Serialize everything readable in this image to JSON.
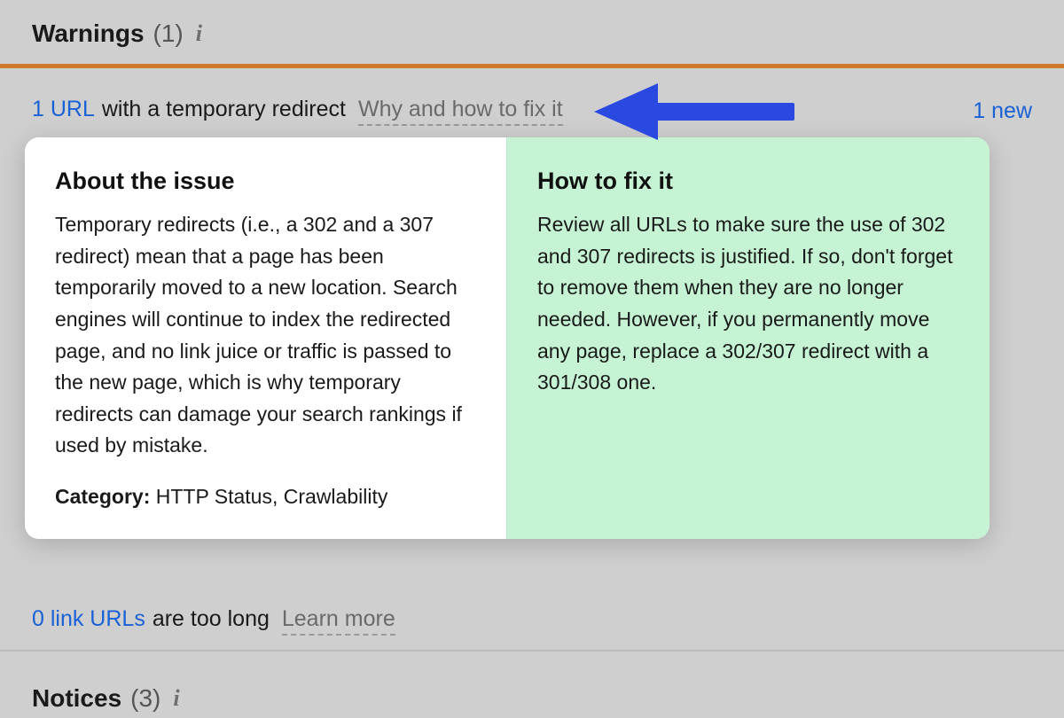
{
  "warnings": {
    "title": "Warnings",
    "count": "(1)"
  },
  "issue1": {
    "count_link": "1 URL",
    "text": "with a temporary redirect",
    "hint": "Why and how to fix it",
    "new_badge": "1 new"
  },
  "tooltip": {
    "about_heading": "About the issue",
    "about_body": "Temporary redirects (i.e., a 302 and a 307 redirect) mean that a page has been temporarily moved to a new location. Search engines will continue to index the redirected page, and no link juice or traffic is passed to the new page, which is why temporary redirects can damage your search rankings if used by mistake.",
    "category_label": "Category:",
    "category_value": " HTTP Status, Crawlability",
    "fix_heading": "How to fix it",
    "fix_body": "Review all URLs to make sure the use of 302 and 307 redirects is justified. If so, don't forget to remove them when they are no longer needed. However, if you permanently move any page, replace a 302/307 redirect with a 301/308 one."
  },
  "issue2": {
    "count_link": "0 link URLs",
    "text": "are too long",
    "hint": "Learn more"
  },
  "notices": {
    "title": "Notices",
    "count": "(3)"
  }
}
